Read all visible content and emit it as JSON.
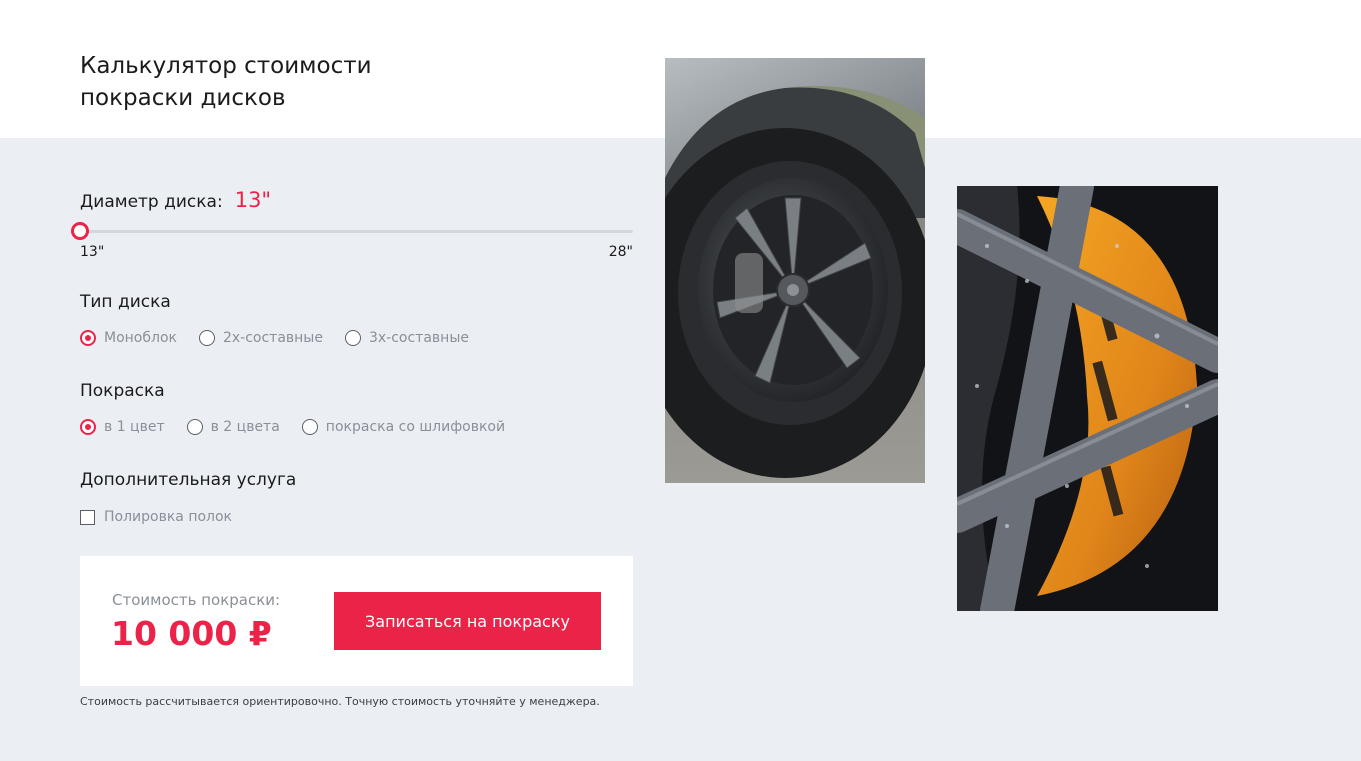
{
  "header": {
    "title_line1": "Калькулятор стоимости",
    "title_line2": "покраски дисков"
  },
  "diameter": {
    "label": "Диаметр диска:",
    "value_text": "13\"",
    "min_label": "13\"",
    "max_label": "28\"",
    "min": 13,
    "max": 28,
    "value": 13
  },
  "disk_type": {
    "title": "Тип диска",
    "options": [
      {
        "label": "Моноблок",
        "checked": true
      },
      {
        "label": "2х-составные",
        "checked": false
      },
      {
        "label": "3х-составные",
        "checked": false
      }
    ]
  },
  "painting": {
    "title": "Покраска",
    "options": [
      {
        "label": "в 1 цвет",
        "checked": true
      },
      {
        "label": "в 2 цвета",
        "checked": false
      },
      {
        "label": "покраска со шлифовкой",
        "checked": false
      }
    ]
  },
  "extra": {
    "title": "Дополнительная услуга",
    "options": [
      {
        "label": "Полировка полок",
        "checked": false
      }
    ]
  },
  "price": {
    "label": "Стоимость покраски:",
    "value": "10 000 ₽",
    "button_label": "Записаться на покраску"
  },
  "note": "Стоимость рассчитывается ориентировочно. Точную стоимость уточняйте у менеджера.",
  "colors": {
    "accent": "#ec2348",
    "background": "#ebeff4",
    "text": "#1b1b1b",
    "muted": "#8a8f99"
  }
}
